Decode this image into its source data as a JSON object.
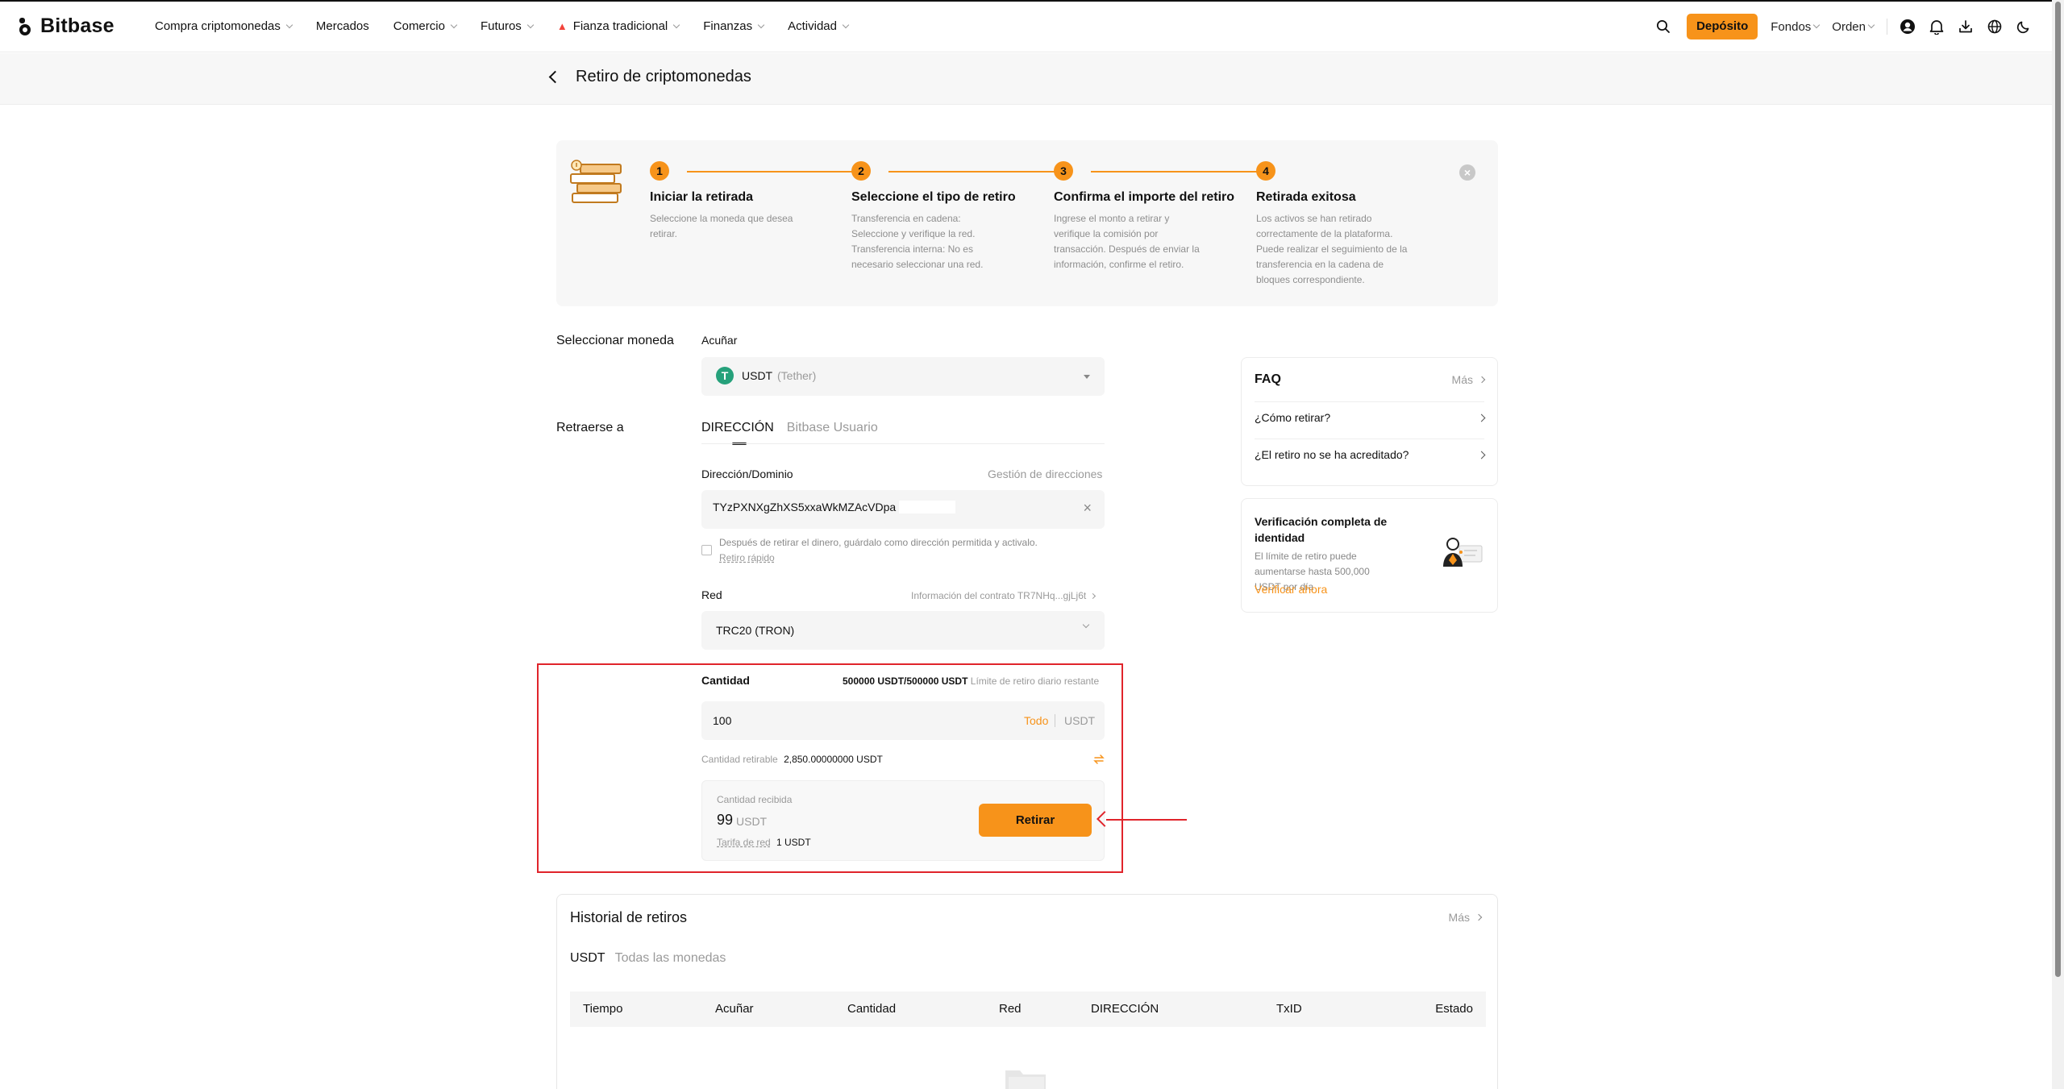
{
  "brand": {
    "name": "Bitbase"
  },
  "nav": {
    "items": [
      {
        "label": "Compra criptomonedas",
        "caret": true,
        "flame": false
      },
      {
        "label": "Mercados",
        "caret": false,
        "flame": false
      },
      {
        "label": "Comercio",
        "caret": true,
        "flame": false
      },
      {
        "label": "Futuros",
        "caret": true,
        "flame": false
      },
      {
        "label": "Fianza tradicional",
        "caret": true,
        "flame": true
      },
      {
        "label": "Finanzas",
        "caret": true,
        "flame": false
      },
      {
        "label": "Actividad",
        "caret": true,
        "flame": false
      }
    ],
    "deposit": "Depósito",
    "funds": "Fondos",
    "order": "Orden"
  },
  "page": {
    "title": "Retiro de criptomonedas"
  },
  "steps": [
    {
      "num": "1",
      "title": "Iniciar la retirada",
      "desc": "Seleccione la moneda que desea retirar."
    },
    {
      "num": "2",
      "title": "Seleccione el tipo de retiro",
      "desc": "Transferencia en cadena: Seleccione y verifique la red. Transferencia interna: No es necesario seleccionar una red."
    },
    {
      "num": "3",
      "title": "Confirma el importe del retiro",
      "desc": "Ingrese el monto a retirar y verifique la comisión por transacción. Después de enviar la información, confirme el retiro."
    },
    {
      "num": "4",
      "title": "Retirada exitosa",
      "desc": "Los activos se han retirado correctamente de la plataforma. Puede realizar el seguimiento de la transferencia en la cadena de bloques correspondiente."
    }
  ],
  "form": {
    "select_coin_label": "Seleccionar moneda",
    "coin_field_label": "Acuñar",
    "coin_symbol": "USDT",
    "coin_name": "(Tether)",
    "coin_icon_letter": "T",
    "withdraw_to_label": "Retraerse a",
    "tab_address": "DIRECCIÓN",
    "tab_user": "Bitbase Usuario",
    "address_label": "Dirección/Dominio",
    "address_manage": "Gestión de direcciones",
    "address_value": "TYzPXNXgZhXS5xxaWkMZAcVDpa",
    "save_address_text": "Después de retirar el dinero, guárdalo como dirección permitida y activalo.",
    "quick_withdraw": "Retiro rápido",
    "network_label": "Red",
    "contract_info": "Información del contrato TR7NHq...gjLj6t",
    "network_value": "TRC20 (TRON)",
    "amount_label": "Cantidad",
    "limit_value": "500000 USDT/500000 USDT",
    "limit_text": "Límite de retiro diario restante",
    "amount_value": "100",
    "all_label": "Todo",
    "amount_unit": "USDT",
    "withdrawable_label": "Cantidad retirable",
    "withdrawable_value": "2,850.00000000 USDT",
    "received_label": "Cantidad recibida",
    "received_value": "99",
    "received_unit": "USDT",
    "fee_label": "Tarifa de red",
    "fee_value": "1 USDT",
    "submit": "Retirar"
  },
  "faq": {
    "title": "FAQ",
    "more": "Más",
    "items": [
      "¿Cómo retirar?",
      "¿El retiro no se ha acreditado?"
    ]
  },
  "verify": {
    "title": "Verificación completa de identidad",
    "desc": "El límite de retiro puede aumentarse hasta 500,000 USDT por día",
    "link": "Verificar ahora"
  },
  "history": {
    "title": "Historial de retiros",
    "more": "Más",
    "filter_active": "USDT",
    "filter_all": "Todas las monedas",
    "columns": [
      "Tiempo",
      "Acuñar",
      "Cantidad",
      "Red",
      "DIRECCIÓN",
      "TxID",
      "Estado"
    ]
  },
  "colors": {
    "accent": "#f7931a",
    "highlight": "#e0242b",
    "tether": "#26a17b"
  }
}
